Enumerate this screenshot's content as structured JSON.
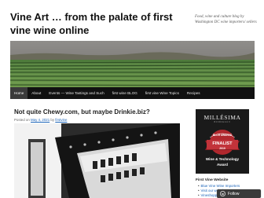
{
  "site": {
    "title": "Vine Art … from the palate of first vine wine online",
    "description": "Food, wine and culture blog by Washington DC wine importers/ sellers"
  },
  "nav": {
    "items": [
      "Home",
      "About",
      "Events — Wine Tastings and Such",
      "first wine BLOG",
      "first vine Wine Topics",
      "Recipes"
    ]
  },
  "post": {
    "title": "Not quite Chewy.com, but maybe Drinkie.biz?",
    "meta_prefix": "Posted on",
    "date": "May 4, 2021",
    "meta_by": "by",
    "author": "firstvine"
  },
  "award": {
    "brand": "MILLÉSIMA",
    "sub": "BORDEAUX",
    "ribbon_top": "BLOG AWARDS",
    "ribbon_mid": "FINALIST",
    "year": "2019",
    "category_line1": "Wine & Technology",
    "category_line2": "Award"
  },
  "sidebar": {
    "widget_title": "First Vine Website",
    "links": [
      "Blue Vine Wine Importers",
      "Visit our website",
      "Vineshoppers first …"
    ]
  },
  "follow": {
    "label": "Follow"
  },
  "colors": {
    "nav_bg": "#111111",
    "link": "#1b63b8",
    "award_ribbon": "#b0282e"
  }
}
